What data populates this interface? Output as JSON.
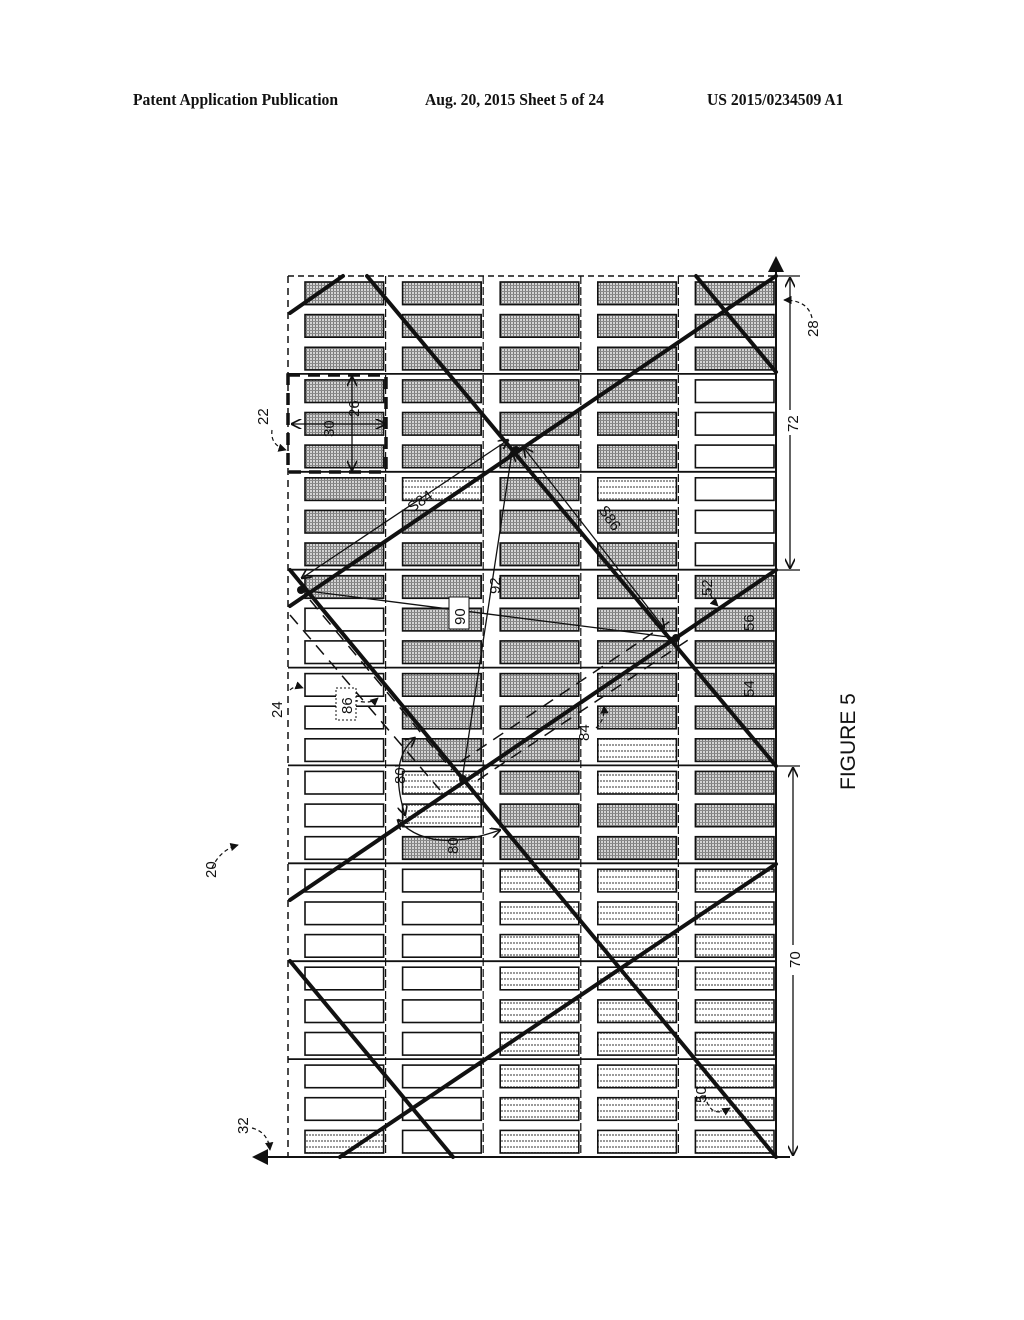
{
  "header": {
    "publication_type": "Patent Application Publication",
    "date_sheet": "Aug. 20, 2015  Sheet 5 of 24",
    "patent_number": "US 2015/0234509 A1"
  },
  "figure": {
    "caption": "FIGURE 5",
    "grid": {
      "columns": 5,
      "rows": 27,
      "row_groups": 9,
      "rows_per_group": 3,
      "cell_states_legend": {
        "D": "dense shading",
        "L": "light shading",
        "E": "unshaded"
      },
      "cell_states_by_column": [
        "DDDDDDDDDDEEEEEEEEEEEEEEEEL",
        "DDDDDDLDDDDDDDDLLDEEEEEEEEE",
        "DDDDDDDDDDDDDDDDDDLLLLLLLLL",
        "DDDDDDLDDDDDDDLLDDLLLLLLLLL",
        "DDDEEEEEEDDDDDDDDDLLLLLLLLL"
      ]
    },
    "reference_labels": [
      {
        "id": "20",
        "text": "20"
      },
      {
        "id": "22",
        "text": "22"
      },
      {
        "id": "24",
        "text": "24"
      },
      {
        "id": "26",
        "text": "26"
      },
      {
        "id": "28",
        "text": "28"
      },
      {
        "id": "30",
        "text": "30"
      },
      {
        "id": "32",
        "text": "32"
      },
      {
        "id": "50",
        "text": "50"
      },
      {
        "id": "52",
        "text": "52"
      },
      {
        "id": "54",
        "text": "54"
      },
      {
        "id": "56",
        "text": "56"
      },
      {
        "id": "70",
        "text": "70"
      },
      {
        "id": "72",
        "text": "72"
      },
      {
        "id": "80",
        "text": "80"
      },
      {
        "id": "80p",
        "text": "80'"
      },
      {
        "id": "84",
        "text": "84"
      },
      {
        "id": "86",
        "text": "86"
      },
      {
        "id": "90",
        "text": "90"
      },
      {
        "id": "92",
        "text": "92"
      },
      {
        "id": "s84",
        "text": "S84"
      },
      {
        "id": "s86",
        "text": "S86"
      }
    ]
  }
}
